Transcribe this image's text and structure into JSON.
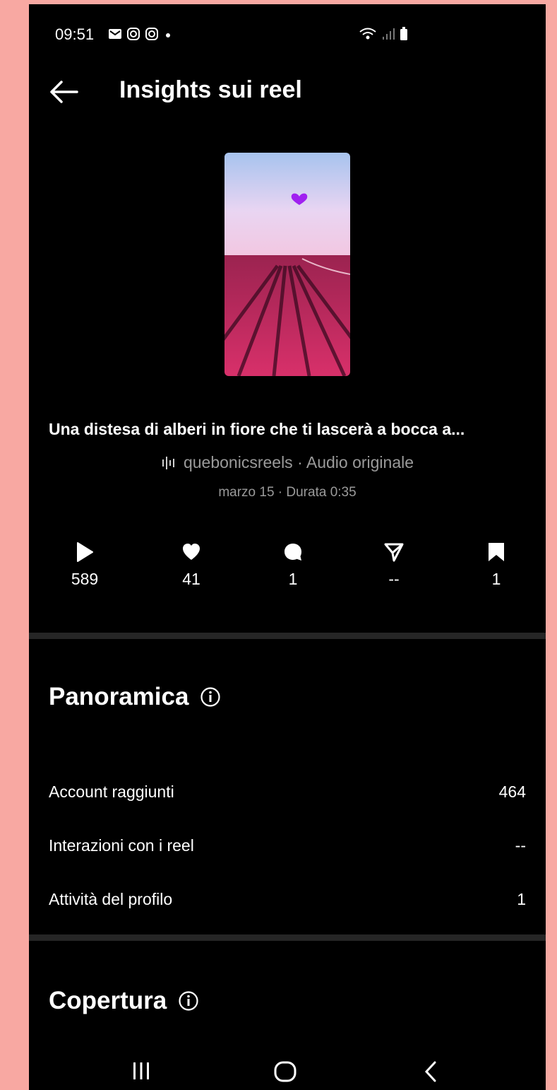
{
  "status_bar": {
    "time": "09:51",
    "left_icons": [
      "mail-icon",
      "instagram-icon",
      "instagram-icon",
      "dot-icon"
    ],
    "right_icons": [
      "wifi-icon",
      "signal-icon",
      "battery-icon"
    ]
  },
  "header": {
    "title": "Insights sui reel"
  },
  "reel": {
    "caption": "Una distesa di alberi in fiore che ti lascerà a bocca a...",
    "audio": "quebonicsreels · Audio originale",
    "meta": "marzo 15 · Durata 0:35"
  },
  "stats": [
    {
      "icon": "play-icon",
      "value": "589"
    },
    {
      "icon": "heart-icon",
      "value": "41"
    },
    {
      "icon": "comment-icon",
      "value": "1"
    },
    {
      "icon": "share-icon",
      "value": "--"
    },
    {
      "icon": "bookmark-icon",
      "value": "1"
    }
  ],
  "overview": {
    "title": "Panoramica",
    "rows": [
      {
        "label": "Account raggiunti",
        "value": "464"
      },
      {
        "label": "Interazioni con i reel",
        "value": "--"
      },
      {
        "label": "Attività del profilo",
        "value": "1"
      }
    ]
  },
  "reach": {
    "title": "Copertura"
  },
  "colors": {
    "background": "#000000",
    "divider": "#262626",
    "muted_text": "#9a9a9a",
    "page_frame": "#f8a8a2",
    "heart": "#a020f0"
  }
}
